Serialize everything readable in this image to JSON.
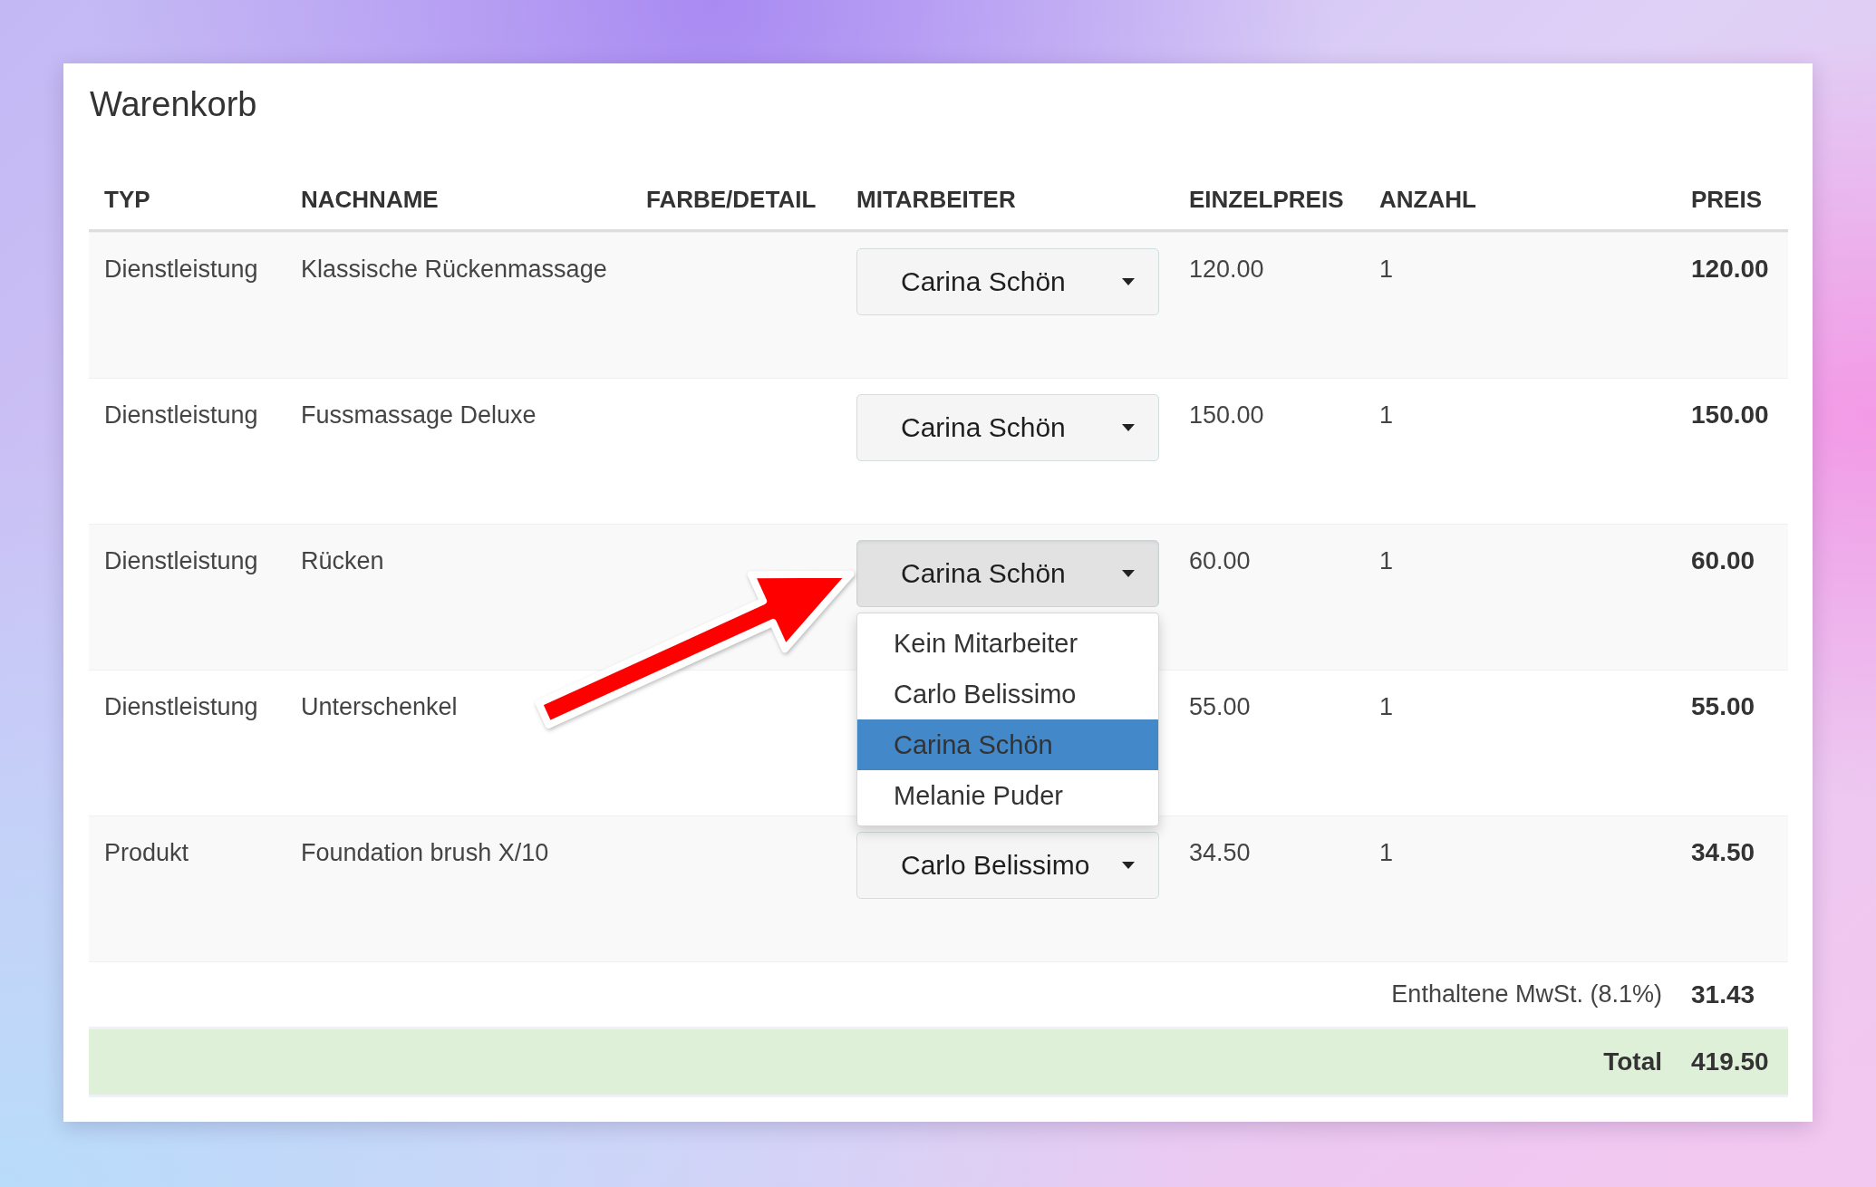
{
  "panel": {
    "title": "Warenkorb"
  },
  "table": {
    "columns": [
      "TYP",
      "NACHNAME",
      "FARBE/DETAIL",
      "MITARBEITER",
      "EINZELPREIS",
      "ANZAHL",
      "PREIS"
    ],
    "rows": [
      {
        "type": "Dienstleistung",
        "name": "Klassische Rückenmassage",
        "employee": {
          "value": "Carina Schön",
          "open": false
        },
        "unit_price": "120.00",
        "quantity": "1",
        "price": "120.00"
      },
      {
        "type": "Dienstleistung",
        "name": "Fussmassage Deluxe",
        "employee": {
          "value": "Carina Schön",
          "open": false
        },
        "unit_price": "150.00",
        "quantity": "1",
        "price": "150.00"
      },
      {
        "type": "Dienstleistung",
        "name": "Rücken",
        "employee": {
          "value": "Carina Schön",
          "open": true,
          "options": [
            {
              "label": "Kein Mitarbeiter",
              "selected": false
            },
            {
              "label": "Carlo Belissimo",
              "selected": false
            },
            {
              "label": "Carina Schön",
              "selected": true
            },
            {
              "label": "Melanie Puder",
              "selected": false
            }
          ]
        },
        "unit_price": "60.00",
        "quantity": "1",
        "price": "60.00"
      },
      {
        "type": "Dienstleistung",
        "name": "Unterschenkel",
        "unit_price": "55.00",
        "quantity": "1",
        "price": "55.00"
      },
      {
        "type": "Produkt",
        "name": "Foundation brush X/10",
        "employee": {
          "value": "Carlo Belissimo",
          "open": false
        },
        "unit_price": "34.50",
        "quantity": "1",
        "price": "34.50"
      }
    ]
  },
  "summary": [
    {
      "kind": "tax",
      "label": "Enthaltene MwSt. (8.1%)",
      "value": "31.43"
    },
    {
      "kind": "total",
      "label": "Total",
      "value": "419.50"
    }
  ]
}
